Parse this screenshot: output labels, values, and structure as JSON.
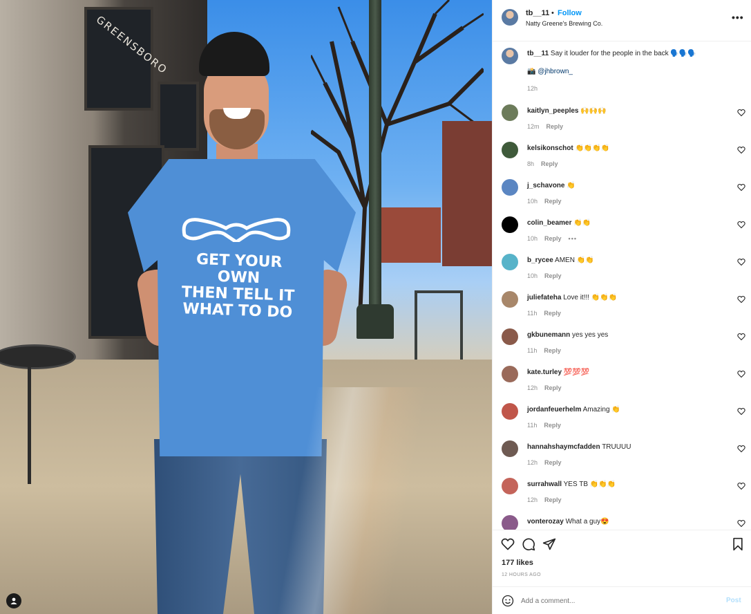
{
  "post": {
    "username": "tb__11",
    "separator": "•",
    "follow_label": "Follow",
    "location": "Natty Greene's Brewing Co.",
    "more_icon": "more-horizontal-icon",
    "image": {
      "storefront_sign": "GREENSBORO",
      "shirt_text_line1": "GET YOUR OWN",
      "shirt_text_line2": "THEN TELL IT",
      "shirt_text_line3": "WHAT TO DO",
      "tag_icon": "user-tag-icon"
    }
  },
  "caption": {
    "username": "tb__11",
    "text": "Say it louder for the people in the back 🗣️🗣️🗣️",
    "credit_prefix": "📸",
    "credit_mention": "@jhbrown_",
    "time": "12h"
  },
  "comments": [
    {
      "user": "kaitlyn_peeples",
      "text": "🙌🙌🙌",
      "time": "12m",
      "reply": "Reply",
      "avatar_color": "#6c7b5a"
    },
    {
      "user": "kelsikonschot",
      "text": "👏👏👏👏",
      "time": "8h",
      "reply": "Reply",
      "avatar_color": "#3f5a3a"
    },
    {
      "user": "j_schavone",
      "text": "👏",
      "time": "10h",
      "reply": "Reply",
      "avatar_color": "#5b86c2"
    },
    {
      "user": "colin_beamer",
      "text": "👏👏",
      "time": "10h",
      "reply": "Reply",
      "avatar_color": "#000000",
      "more": "•••"
    },
    {
      "user": "b_rycee",
      "text": "AMEN 👏👏",
      "time": "10h",
      "reply": "Reply",
      "avatar_color": "#57b3c9"
    },
    {
      "user": "juliefateha",
      "text": "Love it!!! 👏👏👏",
      "time": "11h",
      "reply": "Reply",
      "avatar_color": "#a8876a"
    },
    {
      "user": "gkbunemann",
      "text": "yes yes yes",
      "time": "11h",
      "reply": "Reply",
      "avatar_color": "#8a5a4a"
    },
    {
      "user": "kate.turley",
      "text": "💯💯💯",
      "time": "12h",
      "reply": "Reply",
      "avatar_color": "#9a6a5a"
    },
    {
      "user": "jordanfeuerhelm",
      "text": "Amazing 👏",
      "time": "11h",
      "reply": "Reply",
      "avatar_color": "#c0564a"
    },
    {
      "user": "hannahshaymcfadden",
      "text": "TRUUUU",
      "time": "12h",
      "reply": "Reply",
      "avatar_color": "#6e5a52"
    },
    {
      "user": "surrahwall",
      "text": "YES TB 👏👏👏",
      "time": "12h",
      "reply": "Reply",
      "avatar_color": "#c4645a"
    },
    {
      "user": "vonterozay",
      "text": "What a guy😍",
      "time": "",
      "reply": "",
      "avatar_color": "#8a5a8a"
    }
  ],
  "actions": {
    "like_icon": "heart-icon",
    "comment_icon": "comment-icon",
    "share_icon": "send-icon",
    "save_icon": "bookmark-icon",
    "likes": "177 likes",
    "time_ago": "12 HOURS AGO"
  },
  "composer": {
    "emoji_icon": "emoji-icon",
    "placeholder": "Add a comment...",
    "post_label": "Post"
  },
  "colors": {
    "accent": "#0095f6",
    "post_disabled": "#b2dffc",
    "muted": "#8e8e8e",
    "text": "#262626",
    "mention": "#00376b"
  }
}
